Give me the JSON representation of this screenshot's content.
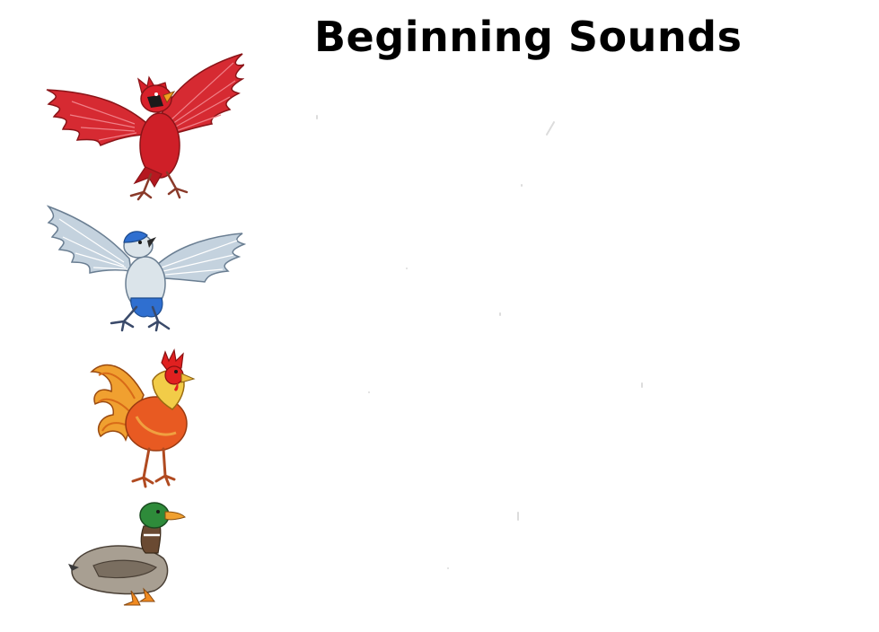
{
  "worksheet": {
    "title": "Beginning Sounds",
    "pictures": [
      {
        "name": "cardinal",
        "icon": "cardinal-icon",
        "color": "#d8202a"
      },
      {
        "name": "blue jay",
        "icon": "blue-jay-icon",
        "color": "#2f6fd0"
      },
      {
        "name": "rooster",
        "icon": "rooster-icon",
        "color": "#e85a22"
      },
      {
        "name": "duck",
        "icon": "duck-icon",
        "color": "#2e8b3a"
      }
    ]
  }
}
